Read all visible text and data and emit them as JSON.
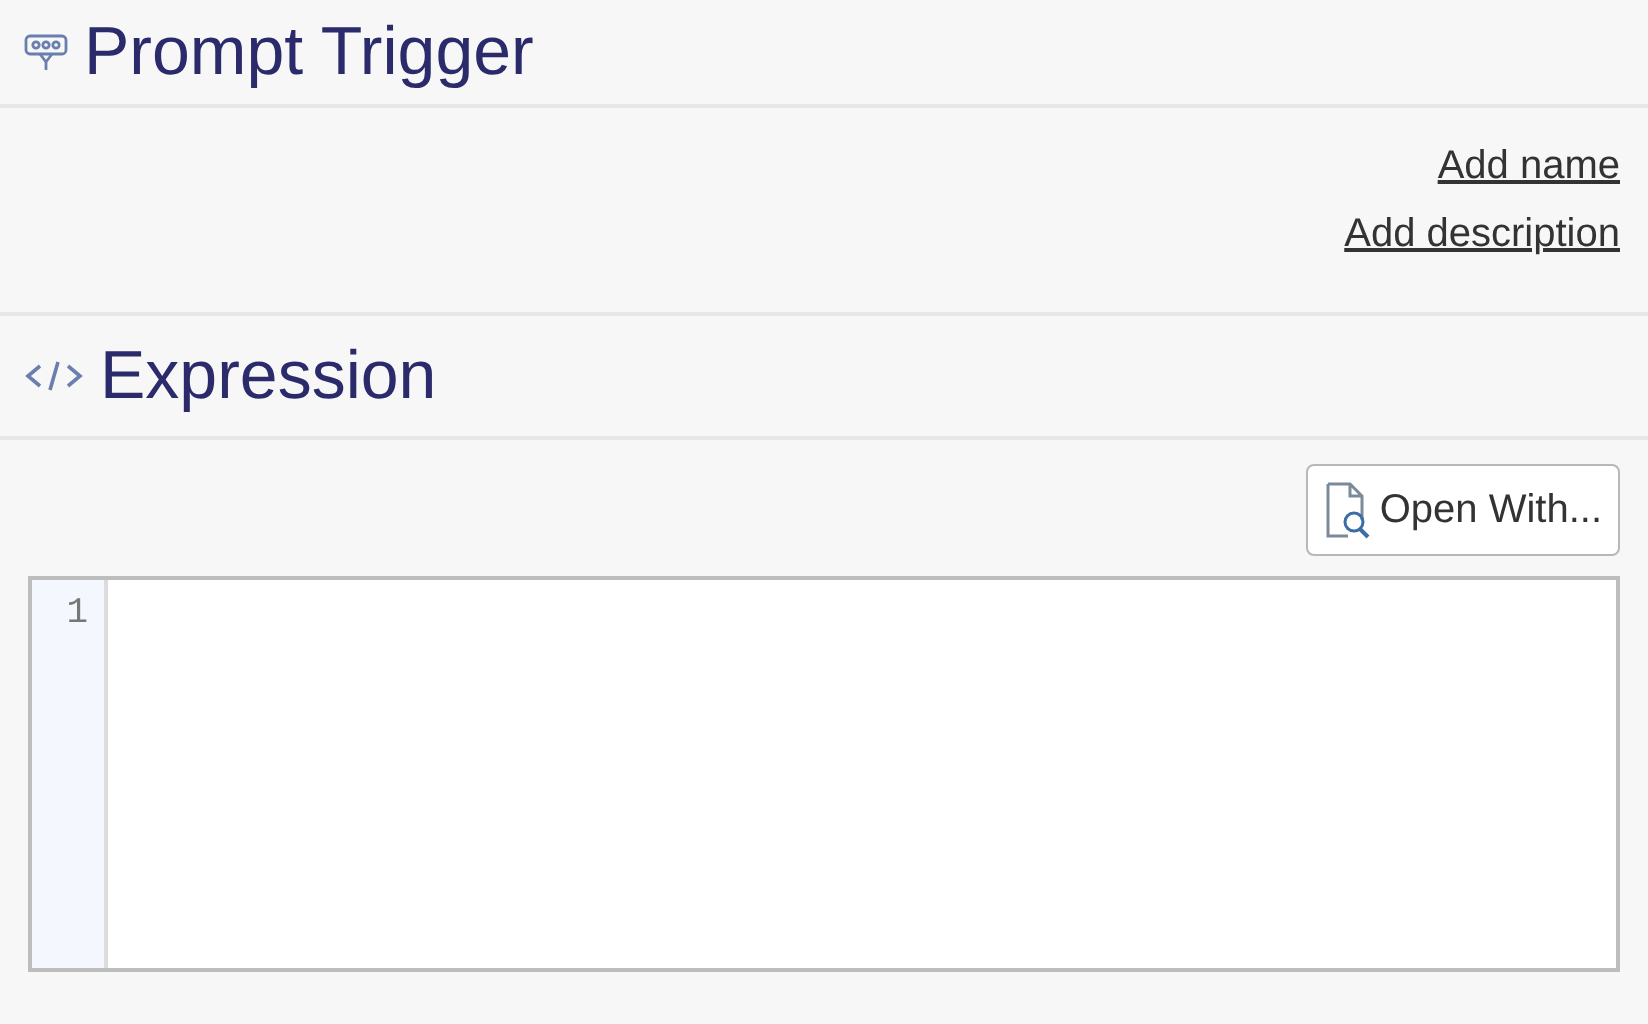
{
  "header": {
    "title": "Prompt Trigger"
  },
  "links": [
    "Add name",
    "Add description"
  ],
  "expression": {
    "title": "Expression",
    "button": "Open With...",
    "line_numbers": [
      "1"
    ]
  }
}
